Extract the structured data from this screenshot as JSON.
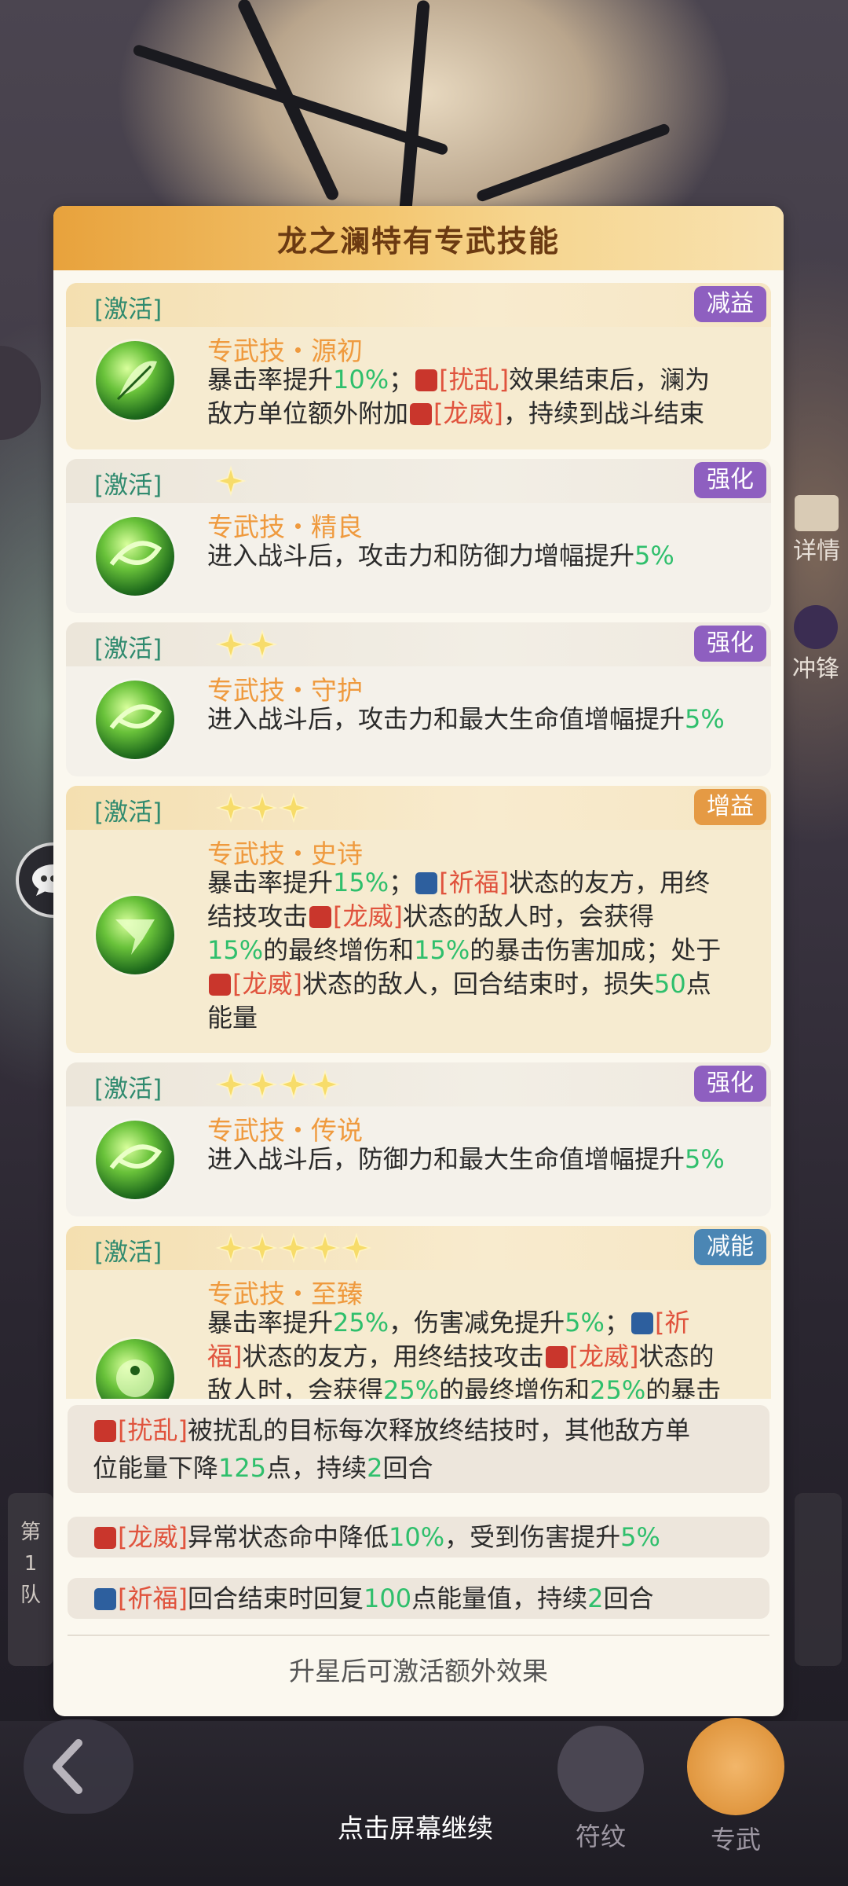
{
  "panel": {
    "title": "龙之澜特有专武技能",
    "activate_label": "[激活]"
  },
  "skills": [
    {
      "stars": 0,
      "tag": "减益",
      "tag_color": "purple",
      "name": "专武技・源初"
    },
    {
      "stars": 1,
      "tag": "强化",
      "tag_color": "purple",
      "name": "专武技・精良"
    },
    {
      "stars": 2,
      "tag": "强化",
      "tag_color": "purple",
      "name": "专武技・守护"
    },
    {
      "stars": 3,
      "tag": "增益",
      "tag_color": "orange",
      "name": "专武技・史诗"
    },
    {
      "stars": 4,
      "tag": "强化",
      "tag_color": "purple",
      "name": "专武技・传说"
    },
    {
      "stars": 5,
      "tag": "减能",
      "tag_color": "blue",
      "name": "专武技・至臻"
    }
  ],
  "text": {
    "crit_rate_up": "暴击率提升",
    "pct10": "10%",
    "pct15": "15%",
    "pct25": "25%",
    "pct5": "5%",
    "semicolon": "；",
    "disrupt": "[扰乱]",
    "dragon_might": "[龙威]",
    "blessing": "[祈福]",
    "s1_mid": "效果结束后，澜为",
    "s1_tail_a": "敌方单位额外附加",
    "s1_tail_b": "，持续到战斗结束",
    "s2_desc": "进入战斗后，攻击力和防御力增幅提升",
    "s3_desc": "进入战斗后，攻击力和最大生命值增幅提升",
    "s4_a": "状态的友方，用终",
    "s4_b": "结技攻击",
    "s4_c": "状态的敌人时，会获得",
    "s4_d": "的最终增伤和",
    "s4_e": "的暴击伤害加成；处于",
    "s4_f": "状态的敌人，回合结束时，损失",
    "s4_50": "50",
    "s4_g": "点",
    "s4_h": "能量",
    "s5_desc": "进入战斗后，防御力和最大生命值增幅提升",
    "s6_dmg_red": "，伤害减免提升",
    "s6_blessing_a": "[祈",
    "s6_blessing_b": "福]",
    "s6_b": "状态的友方，用终结技攻击",
    "s6_c": "状态的",
    "s6_d": "敌人时，会获得",
    "s6_e": "的最终增伤和",
    "s6_f": "的暴击"
  },
  "footnotes": {
    "disrupt_a": "被扰乱的目标每次释放终结技时，其他敌方单",
    "disrupt_b": "位能量下降",
    "disrupt_125": "125",
    "disrupt_c": "点，持续",
    "disrupt_2": "2",
    "disrupt_d": "回合",
    "dragon_a": "异常状态命中降低",
    "dragon_10": "10%",
    "dragon_b": "，受到伤害提升",
    "dragon_5": "5%",
    "bless_a": "回合结束时回复",
    "bless_100": "100",
    "bless_b": "点能量值，持续",
    "bless_2": "2",
    "bless_c": "回合"
  },
  "bottom_note": "升星后可激活额外效果",
  "continue_hint": "点击屏幕继续",
  "nav": {
    "rune": "符纹",
    "weapon": "专武"
  },
  "side": {
    "details": "详情",
    "charge": "冲锋",
    "team_label_1": "第",
    "team_label_2": "1",
    "team_label_3": "队"
  },
  "colors": {
    "header_orange": "#e8a23c",
    "skill_name": "#ef9a3e",
    "activate_green": "#2f8a6e",
    "value_green": "#2fbf6c",
    "status_red": "#e0533d",
    "tag_purple": "#8e5fc0",
    "tag_orange": "#e59a44",
    "tag_blue": "#4b86b4"
  }
}
